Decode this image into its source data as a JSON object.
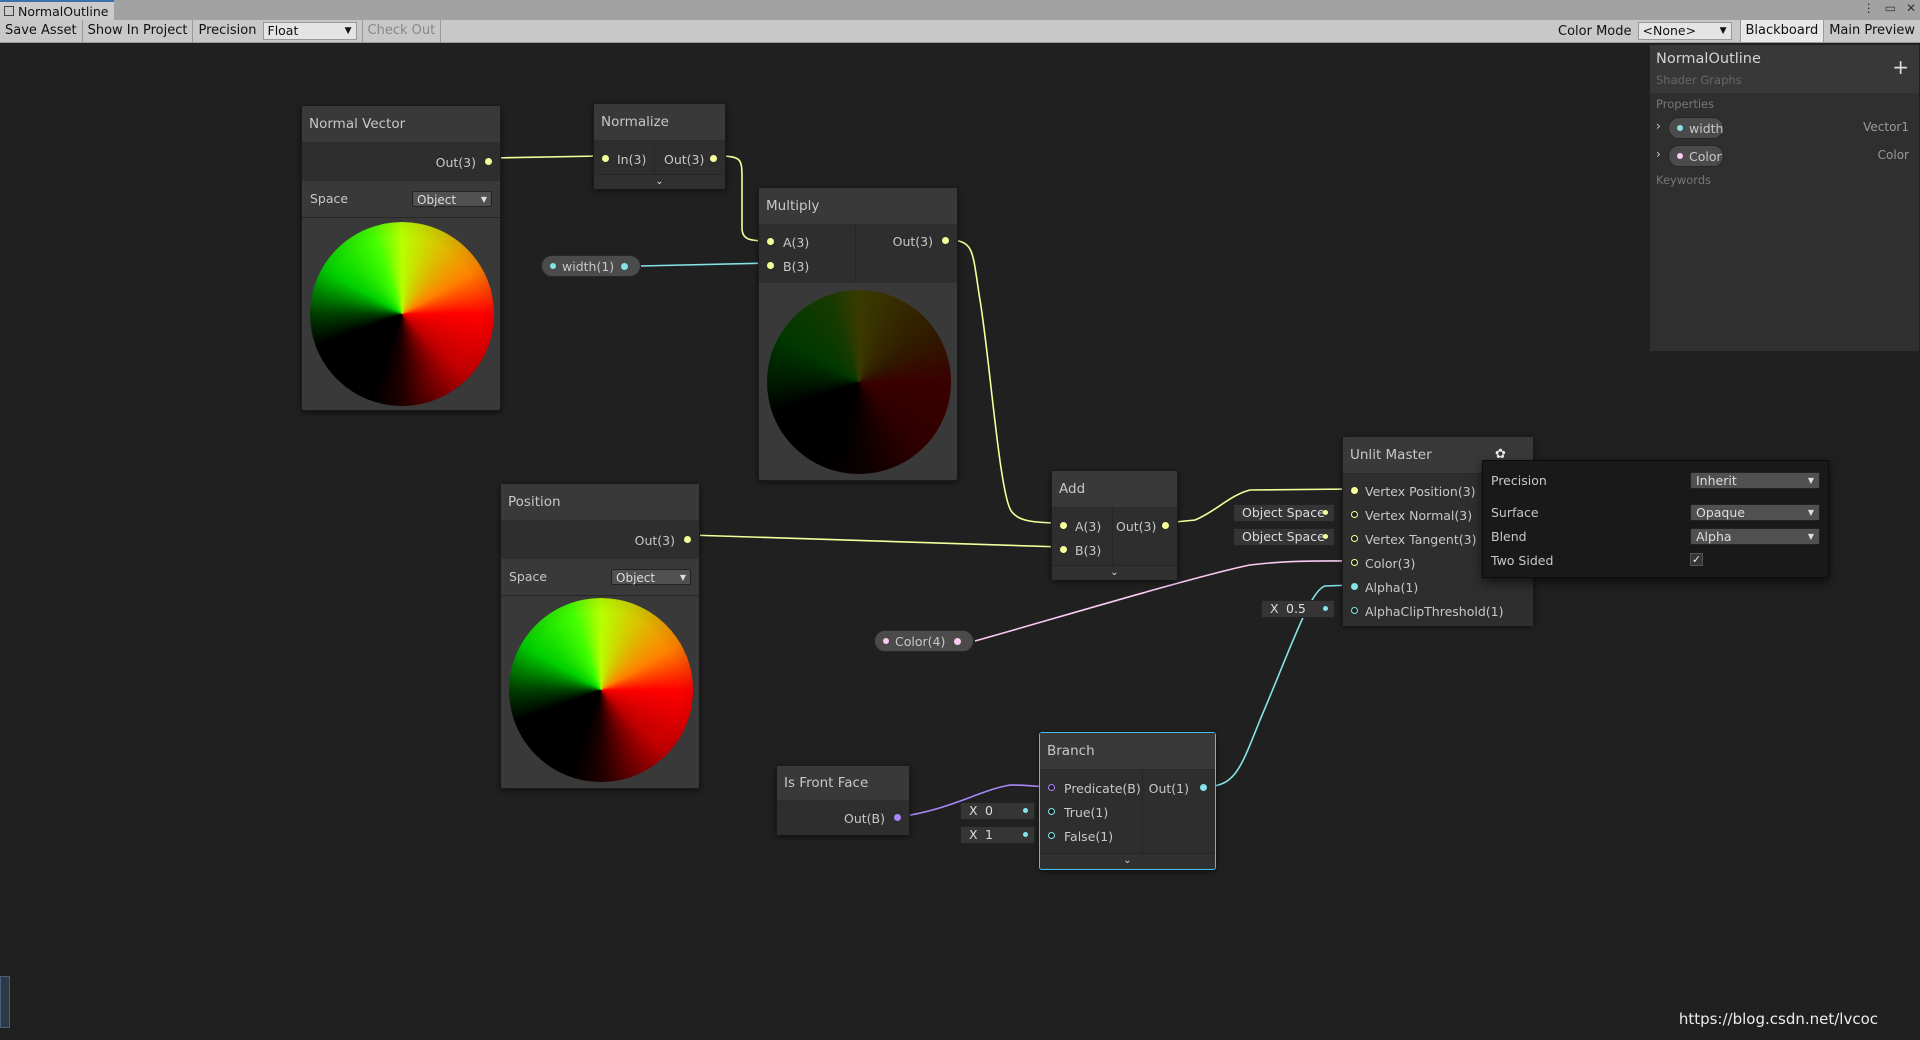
{
  "window": {
    "tab_title": "NormalOutline",
    "controls": [
      "⋮",
      "▭",
      "✕"
    ]
  },
  "toolbar": {
    "save_asset": "Save Asset",
    "show_in_project": "Show In Project",
    "precision_label": "Precision",
    "precision_value": "Float",
    "check_out": "Check Out",
    "color_mode_label": "Color Mode",
    "color_mode_value": "<None>",
    "blackboard": "Blackboard",
    "main_preview": "Main Preview"
  },
  "nodes": {
    "normal_vector": {
      "title": "Normal Vector",
      "out": "Out(3)",
      "space_label": "Space",
      "space_value": "Object"
    },
    "normalize": {
      "title": "Normalize",
      "in": "In(3)",
      "out": "Out(3)"
    },
    "multiply": {
      "title": "Multiply",
      "a": "A(3)",
      "b": "B(3)",
      "out": "Out(3)"
    },
    "position": {
      "title": "Position",
      "out": "Out(3)",
      "space_label": "Space",
      "space_value": "Object"
    },
    "add": {
      "title": "Add",
      "a": "A(3)",
      "b": "B(3)",
      "out": "Out(3)"
    },
    "unlit_master": {
      "title": "Unlit Master",
      "ports": [
        "Vertex Position(3)",
        "Vertex Normal(3)",
        "Vertex Tangent(3)",
        "Color(3)",
        "Alpha(1)",
        "AlphaClipThreshold(1)"
      ],
      "vertex_normal_default": "Object Space",
      "vertex_tangent_default": "Object Space",
      "alpha_clip_axis": "X",
      "alpha_clip_value": "0.5"
    },
    "is_front_face": {
      "title": "Is Front Face",
      "out": "Out(B)"
    },
    "branch": {
      "title": "Branch",
      "predicate": "Predicate(B)",
      "true": "True(1)",
      "false": "False(1)",
      "out": "Out(1)",
      "true_axis": "X",
      "true_value": "0",
      "false_axis": "X",
      "false_value": "1"
    }
  },
  "property_nodes": {
    "width": "width(1)",
    "color": "Color(4)"
  },
  "blackboard": {
    "title": "NormalOutline",
    "subtitle": "Shader Graphs",
    "add_button": "+",
    "properties_label": "Properties",
    "properties": [
      {
        "name": "width",
        "type": "Vector1"
      },
      {
        "name": "Color",
        "type": "Color"
      }
    ],
    "keywords_label": "Keywords"
  },
  "master_settings": {
    "precision_label": "Precision",
    "precision_value": "Inherit",
    "surface_label": "Surface",
    "surface_value": "Opaque",
    "blend_label": "Blend",
    "blend_value": "Alpha",
    "two_sided_label": "Two Sided",
    "two_sided_checked": true
  },
  "port_colors": {
    "vector3": "#f6ff9a",
    "vector1": "#84e4e7",
    "boolean": "#a887f8",
    "vector4": "#fbcbf4"
  },
  "watermark": "https://blog.csdn.net/lvcoc"
}
